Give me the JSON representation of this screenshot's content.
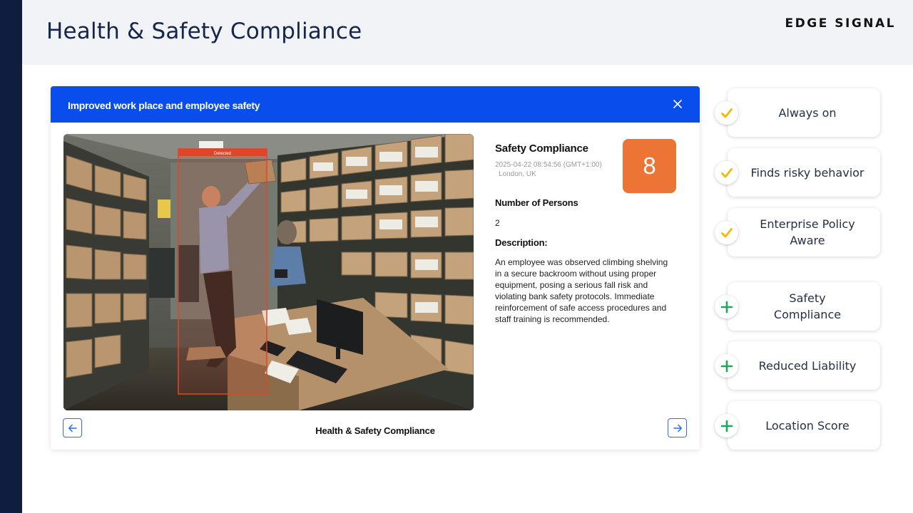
{
  "header": {
    "title": "Health & Safety Compliance",
    "brand": "EDGE SIGNAL"
  },
  "card": {
    "title": "Improved work place and employee safety",
    "image_label": "Detected",
    "event": {
      "title": "Safety Compliance",
      "timestamp": "2025-04-22 08:54:56 (GMT+1:00)",
      "location": "London, UK",
      "score": "8",
      "persons_label": "Number of Persons",
      "persons_value": "2",
      "description_label": "Description:",
      "description": "An employee was observed climbing shelving in a secure backroom without using proper equipment, posing a serious fall risk and violating bank safety protocols. Immediate reinforcement of safe access procedures and staff training is recommended."
    },
    "footer_title": "Health & Safety Compliance"
  },
  "features": [
    {
      "label": "Always on",
      "icon": "check-icon"
    },
    {
      "label": "Finds risky behavior",
      "icon": "check-icon"
    },
    {
      "label": "Enterprise Policy Aware",
      "icon": "check-icon"
    },
    {
      "label": "Safety Compliance",
      "icon": "plus-icon"
    },
    {
      "label": "Reduced Liability",
      "icon": "plus-icon"
    },
    {
      "label": "Location Score",
      "icon": "plus-icon"
    }
  ],
  "colors": {
    "sidebar": "#0f1e3f",
    "header_bg": "#f1f3f7",
    "card_header": "#0a4ded",
    "score_badge": "#ec7535",
    "check": "#f5b800",
    "plus": "#1fa65a",
    "detection_box": "#e0452b"
  }
}
